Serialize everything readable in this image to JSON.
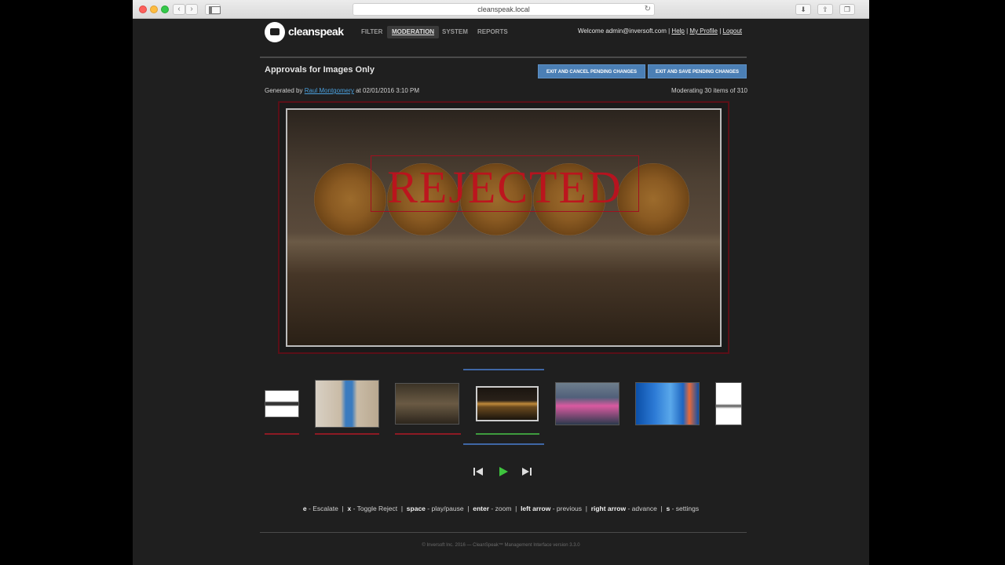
{
  "browser": {
    "url": "cleanspeak.local"
  },
  "app": {
    "logo": "cleanspeak"
  },
  "nav": {
    "filter": "FILTER",
    "moderation": "MODERATION",
    "system": "SYSTEM",
    "reports": "REPORTS"
  },
  "user": {
    "welcome": "Welcome admin@inversoft.com",
    "help": "Help",
    "profile": "My Profile",
    "logout": "Logout",
    "sep": "|"
  },
  "page": {
    "title": "Approvals for Images Only",
    "exit_cancel": "EXIT AND CANCEL PENDING CHANGES",
    "exit_save": "EXIT AND SAVE PENDING CHANGES",
    "generated_prefix": "Generated by",
    "generated_user": "Raul Montgomery",
    "generated_suffix": "at 02/01/2016 3:10 PM",
    "moderating": "Moderating 30 items of 310"
  },
  "image": {
    "stamp": "REJECTED"
  },
  "shortcuts": [
    {
      "key": "e",
      "desc": "- Escalate"
    },
    {
      "key": "x",
      "desc": "- Toggle Reject"
    },
    {
      "key": "space",
      "desc": "- play/pause"
    },
    {
      "key": "enter",
      "desc": "- zoom"
    },
    {
      "key": "left arrow",
      "desc": "- previous"
    },
    {
      "key": "right arrow",
      "desc": "- advance"
    },
    {
      "key": "s",
      "desc": "- settings"
    }
  ],
  "footer": "© Inversoft Inc. 2016 — CleanSpeak™ Management Interface version 3.3.0",
  "colors": {
    "accent": "#4b7fb5",
    "reject": "#8d1a24",
    "approve": "#3e9b3e",
    "selection": "#3f67a5"
  }
}
